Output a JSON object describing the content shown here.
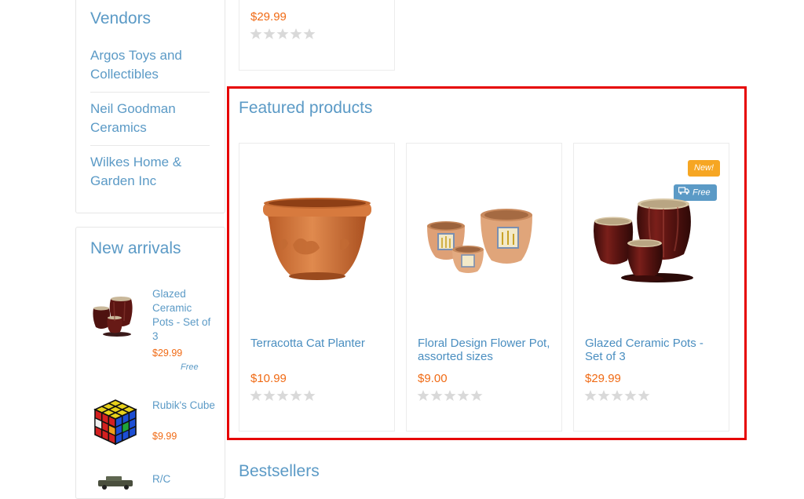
{
  "vendors": {
    "title": "Vendors",
    "items": [
      {
        "label": "Argos Toys and Collectibles"
      },
      {
        "label": "Neil Goodman Ceramics"
      },
      {
        "label": "Wilkes Home & Garden Inc"
      }
    ]
  },
  "new_arrivals": {
    "title": "New arrivals",
    "items": [
      {
        "name": "Glazed Ceramic Pots - Set of 3",
        "price": "$29.99",
        "badge": "Free"
      },
      {
        "name": "Rubik's Cube",
        "price": "$9.99"
      },
      {
        "name": "R/C"
      }
    ]
  },
  "top_card": {
    "price": "$29.99",
    "rating": 0
  },
  "featured": {
    "title": "Featured products",
    "products": [
      {
        "name": "Terracotta Cat Planter",
        "price": "$10.99",
        "rating": 0
      },
      {
        "name": "Floral Design Flower Pot, assorted sizes",
        "price": "$9.00",
        "rating": 0
      },
      {
        "name": "Glazed Ceramic Pots - Set of 3",
        "price": "$29.99",
        "rating": 0,
        "badge_new": "New!",
        "badge_free": "Free"
      }
    ]
  },
  "bestsellers": {
    "title": "Bestsellers"
  },
  "colors": {
    "link": "#5b9ac6",
    "price": "#f06a14",
    "new_badge": "#f6a623",
    "free_badge": "#5b9ac6",
    "highlight": "#e60000",
    "star_empty": "#d9d9d9"
  },
  "icons": [
    "star-icon",
    "truck-icon"
  ]
}
